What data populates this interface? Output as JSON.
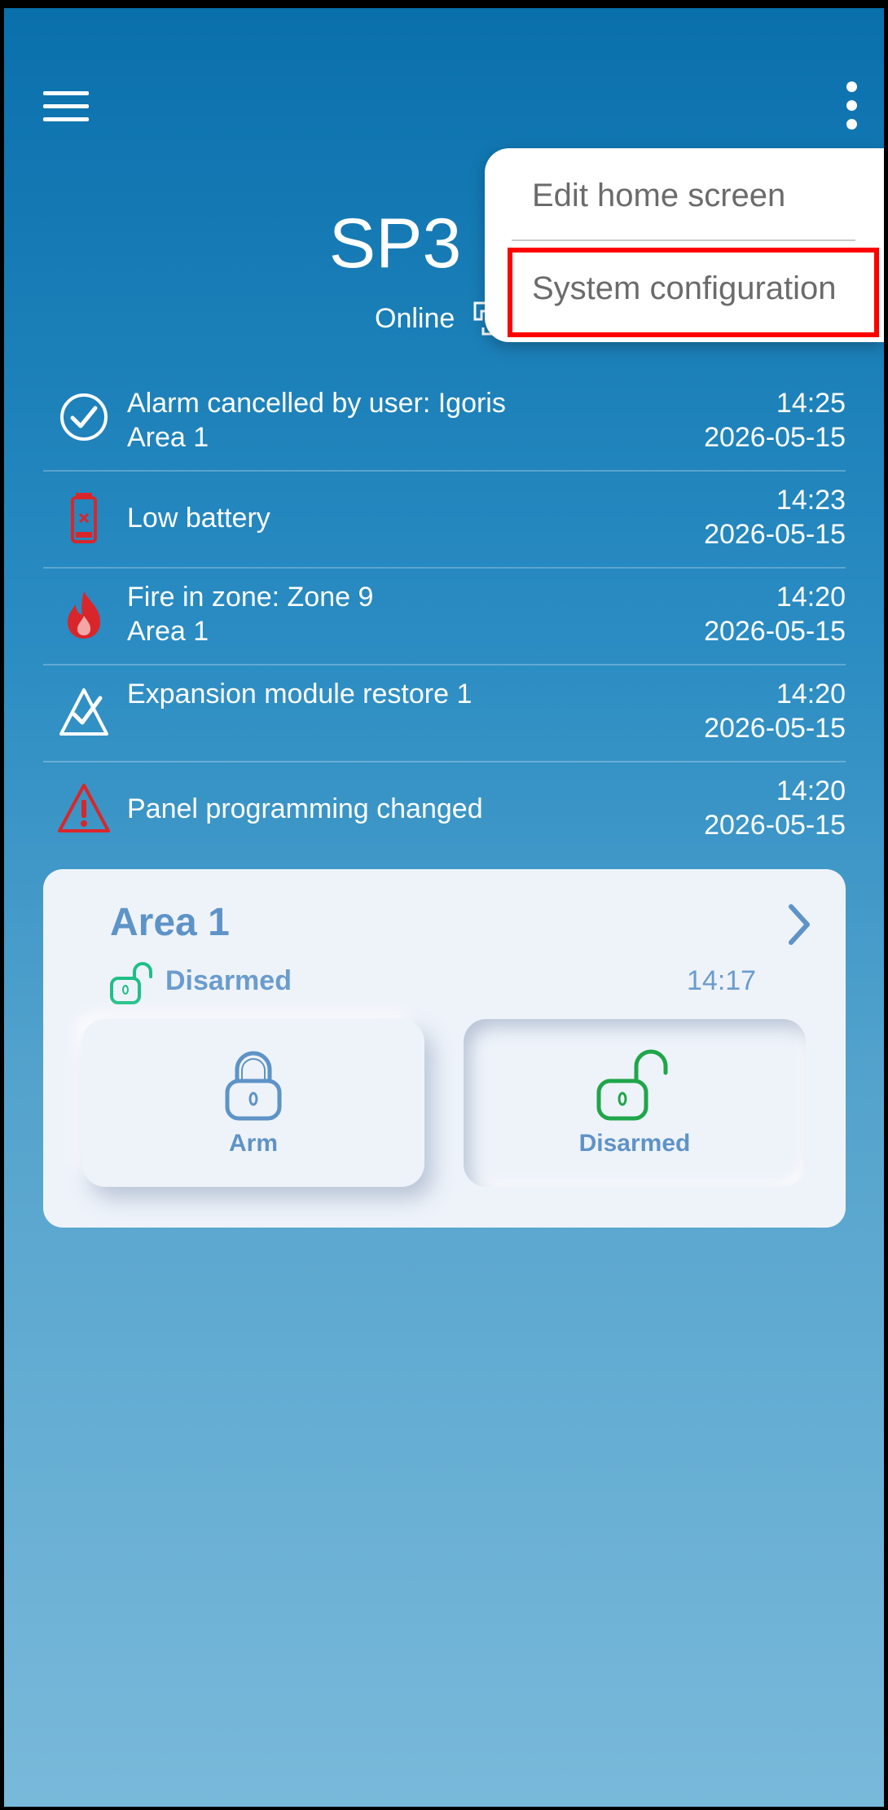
{
  "header": {
    "title": "SP3",
    "status": "Online"
  },
  "menu": {
    "items": [
      {
        "label": "Edit home screen"
      },
      {
        "label": "System configuration"
      }
    ]
  },
  "events": [
    {
      "icon": "check-circle-icon",
      "line1": "Alarm cancelled by user: Igoris",
      "line2": "Area 1",
      "time": "14:25",
      "date": "2026-05-15"
    },
    {
      "icon": "low-battery-icon",
      "line1": "Low battery",
      "line2": "",
      "time": "14:23",
      "date": "2026-05-15"
    },
    {
      "icon": "fire-icon",
      "line1": "Fire in zone: Zone 9",
      "line2": "Area 1",
      "time": "14:20",
      "date": "2026-05-15"
    },
    {
      "icon": "module-restore-icon",
      "line1": "Expansion module restore 1",
      "line2": "",
      "time": "14:20",
      "date": "2026-05-15"
    },
    {
      "icon": "warning-icon",
      "line1": "Panel programming changed",
      "line2": "",
      "time": "14:20",
      "date": "2026-05-15"
    }
  ],
  "area": {
    "name": "Area 1",
    "status": "Disarmed",
    "time": "14:17",
    "arm_label": "Arm",
    "disarm_label": "Disarmed"
  },
  "colors": {
    "accent": "#5e93c7",
    "alert_red": "#d9262b",
    "disarmed_green": "#1fa64a",
    "highlight_red": "#ff0000"
  }
}
